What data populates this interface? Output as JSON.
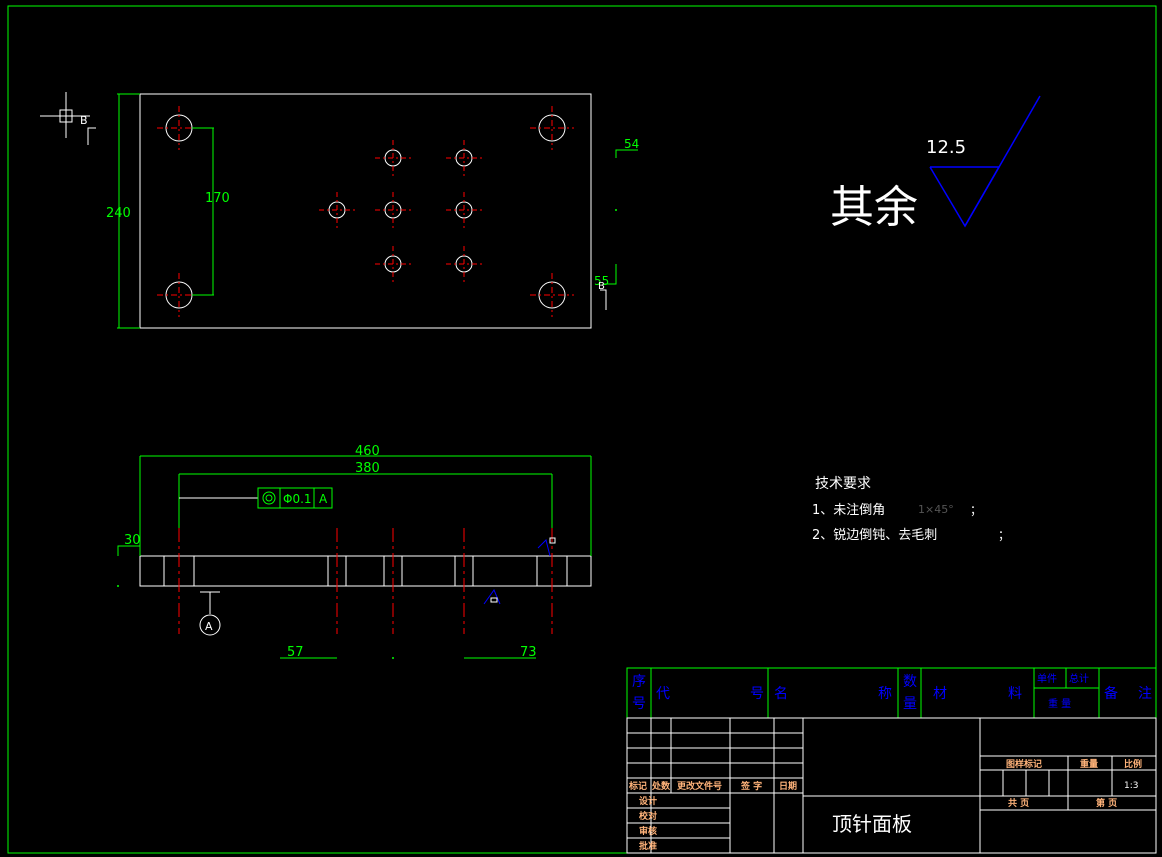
{
  "colors": {
    "background": "#000000",
    "frame": "#00ff00",
    "outline": "#ffffff",
    "centerline": "#ff0000",
    "dimension": "#00ff00",
    "roughness": "#0000ff",
    "title_block_header": "#0000ff",
    "title_block_blue_text": "#4a6aff",
    "title_block_orange_text": "#ffb37a",
    "grid": "#ffffff"
  },
  "top_view": {
    "dim_height": "240",
    "dim_hole_spacing": "170",
    "dim_54": "54",
    "dim_55": "55",
    "section_b": "B",
    "section_b2": "B"
  },
  "front_view": {
    "dim_overall": "460",
    "dim_holes": "380",
    "dim_thickness": "30",
    "dim_57": "57",
    "dim_73": "73",
    "gdt_value": "Φ0.1",
    "gdt_datum": "A",
    "datum_label": "A"
  },
  "roughness_note": {
    "prefix": "其余",
    "value": "12.5"
  },
  "tech_req": {
    "title": "技术要求",
    "item1": "1、未注倒角",
    "item1_dim": "1×45°",
    "item1_end": "；",
    "item2": "2、锐边倒钝、去毛刺",
    "item2_end": "；"
  },
  "bom_header": {
    "seq1": "序",
    "seq2": "号",
    "code1": "代",
    "code2": "号",
    "name1": "名",
    "name2": "称",
    "qty1": "数",
    "qty2": "量",
    "mat1": "材",
    "mat2": "料",
    "unit": "单件",
    "total": "总计",
    "weight": "重   量",
    "remark1": "备",
    "remark2": "注"
  },
  "title_block": {
    "label_mark": "标记",
    "label_count": "处数",
    "label_doc": "更改文件号",
    "label_sign": "签 字",
    "label_date": "日期",
    "label_design": "设计",
    "label_check": "校对",
    "label_review": "审核",
    "label_approve": "批准",
    "label_stage": "图样标记",
    "label_weight": "重量",
    "label_scale": "比例",
    "scale_value": "1:3",
    "label_total_sheets": "共  页",
    "label_sheet": "第  页",
    "part_name": "顶针面板"
  }
}
